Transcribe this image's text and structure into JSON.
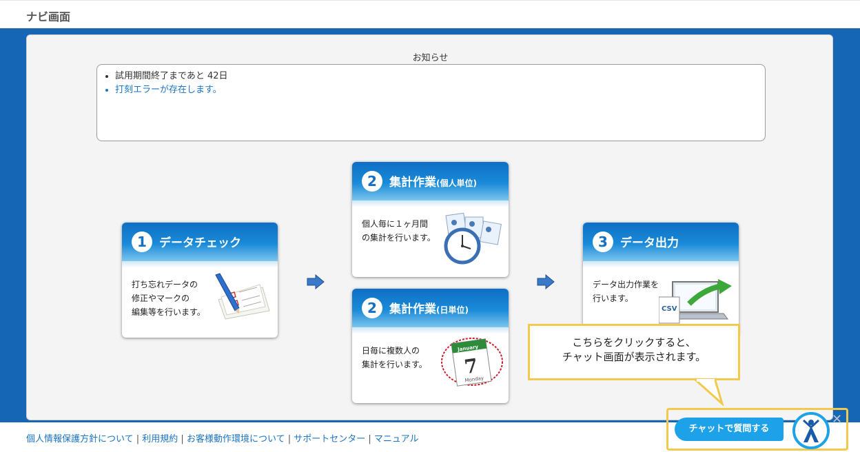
{
  "header": {
    "title": "ナビ画面"
  },
  "notice": {
    "title": "お知らせ",
    "items": [
      "試用期間終了まであと 42日",
      "打刻エラーが存在します。"
    ]
  },
  "cards": {
    "check": {
      "num": "1",
      "title": "データチェック",
      "desc": [
        "打ち忘れデータの",
        "修正やマークの",
        "編集等を行います。"
      ]
    },
    "sum_person": {
      "num": "2",
      "title": "集計作業",
      "sub": "(個人単位)",
      "desc": [
        "個人毎に１ヶ月間",
        "の集計を行います。"
      ]
    },
    "sum_day": {
      "num": "2",
      "title": "集計作業",
      "sub": "(日単位)",
      "desc": [
        "日毎に複数人の",
        "集計を行います。"
      ],
      "calendar_month": "January",
      "calendar_day": "7",
      "calendar_weekday": "Monday"
    },
    "output": {
      "num": "3",
      "title": "データ出力",
      "desc": [
        "データ出力作業を",
        "行います。"
      ],
      "file_label": "CSV"
    }
  },
  "tooltip": {
    "lines": [
      "こちらをクリックすると、",
      "チャット画面が表示されます。"
    ]
  },
  "footer": {
    "links": [
      "個人情報保護方針について",
      "利用規約",
      "お客様動作環境について",
      "サポートセンター",
      "マニュアル"
    ],
    "separator": " | "
  },
  "chat": {
    "button_label": "チャットで質問する",
    "close_symbol": "✕"
  },
  "colors": {
    "brand_blue": "#1566b4",
    "link": "#1a73c4",
    "chat_blue": "#1da1e8",
    "highlight": "#f2c94c"
  }
}
